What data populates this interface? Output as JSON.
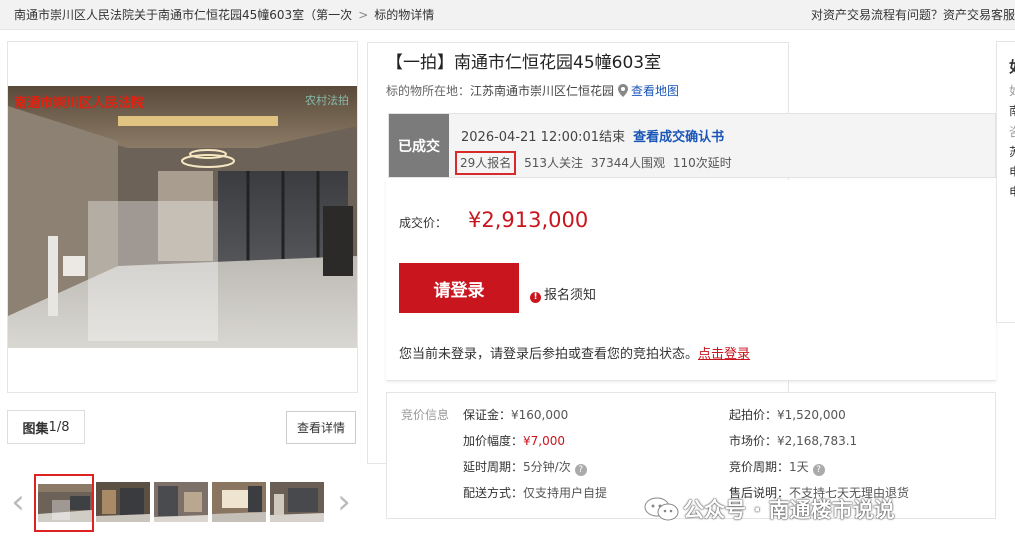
{
  "breadcrumb": {
    "item1": "南通市崇川区人民法院关于南通市仁恒花园45幢603室（第一次",
    "separator": ">",
    "item2": "标的物详情"
  },
  "help_text": "对资产交易流程有问题？资产交易客服",
  "gallery": {
    "watermark_left": "南通市崇川区人民法院",
    "watermark_right": "农村法拍",
    "counter_label": "图集",
    "counter_value": "1/8",
    "detail_button": "查看详情",
    "prev_arrow": "‹",
    "next_arrow": "›"
  },
  "listing": {
    "title": "【一拍】南通市仁恒花园45幢603室",
    "location_label": "标的物所在地：",
    "location_value": "江苏南通市崇川区仁恒花园",
    "map_link": "查看地图",
    "status": "已成交",
    "end_time": "2026-04-21 12:00:01结束",
    "confirm_link": "查看成交确认书",
    "stats": {
      "registered": "29人报名",
      "followers": "513人关注",
      "viewers": "37344人围观",
      "delays": "110次延时"
    }
  },
  "sale": {
    "price_label": "成交价：",
    "price_value": "¥2,913,000",
    "login_button": "请登录",
    "notice_link": "报名须知",
    "login_message": "您当前未登录，请登录后参拍或查看您的竞拍状态。",
    "login_link": "点击登录"
  },
  "bid_info": {
    "title": "竞价信息",
    "deposit_label": "保证金：",
    "deposit_value": "¥160,000",
    "start_label": "起拍价：",
    "start_value": "¥1,520,000",
    "increment_label": "加价幅度：",
    "increment_value": "¥7,000",
    "market_label": "市场价：",
    "market_value": "¥2,168,783.1",
    "delay_label": "延时周期：",
    "delay_value": "5分钟/次",
    "period_label": "竞价周期：",
    "period_value": "1天",
    "delivery_label": "配送方式：",
    "delivery_value": "仅支持用户自提",
    "aftersale_label": "售后说明：",
    "aftersale_value": "不支持七天无理由退货"
  },
  "right_card": {
    "lines": [
      "如",
      "如",
      "南",
      "咨",
      "苏",
      "电",
      "电"
    ]
  },
  "watermark": {
    "text": "公众号 · 南通楼市说说"
  },
  "colors": {
    "accent_red": "#c9151e",
    "link_blue": "#1a56b7",
    "status_gray": "#7b7b7b"
  }
}
